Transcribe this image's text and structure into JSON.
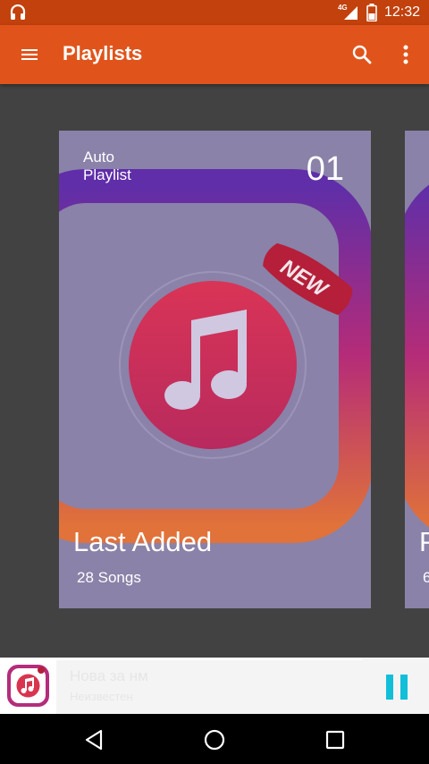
{
  "status_bar": {
    "time": "12:32",
    "network": "4G",
    "icons": [
      "headphones-icon",
      "signal-icon",
      "battery-icon"
    ]
  },
  "app_bar": {
    "title": "Playlists",
    "icons": [
      "menu-icon",
      "search-icon",
      "more-vert-icon"
    ]
  },
  "playlists": [
    {
      "label": "Auto\nPlaylist",
      "number": "01",
      "name": "Last Added",
      "count": "28 Songs",
      "badge": "NEW"
    },
    {
      "label": "",
      "number": "",
      "name": "P",
      "count": "6"
    }
  ],
  "mini_player": {
    "song_title": "Нова за нм",
    "artist": "Неизвестен"
  },
  "colors": {
    "status_bar": "#C2410C",
    "app_bar": "#E0541C",
    "background": "#424242",
    "card_overlay": "#8A82A8",
    "pause_accent": "#11BFD9"
  },
  "nav_bar": {
    "icons": [
      "back-icon",
      "home-icon",
      "recents-icon"
    ]
  }
}
